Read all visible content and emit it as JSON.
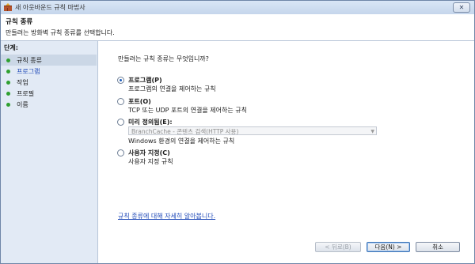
{
  "window": {
    "title": "새 아웃바운드 규칙 마법사",
    "close_glyph": "✕"
  },
  "header": {
    "title": "규칙 종류",
    "subtitle": "만들려는 방화벽 규칙 종류를 선택합니다."
  },
  "steps": {
    "title": "단계:",
    "items": [
      {
        "label": "규칙 종류",
        "active": true
      },
      {
        "label": "프로그램",
        "active": false
      },
      {
        "label": "작업",
        "active": false
      },
      {
        "label": "프로필",
        "active": false
      },
      {
        "label": "이름",
        "active": false
      }
    ]
  },
  "content": {
    "question": "만들려는 규칙 종류는 무엇입니까?",
    "options": [
      {
        "label": "프로그램(P)",
        "desc": "프로그램의 연결을 제어하는 규칙",
        "selected": true
      },
      {
        "label": "포트(O)",
        "desc": "TCP 또는 UDP 포트의 연결을 제어하는 규칙",
        "selected": false
      },
      {
        "label": "미리 정의됨(E):",
        "select_value": "BranchCache - 콘텐츠 검색(HTTP 사용)",
        "desc": "Windows 환경의 연결을 제어하는 규칙",
        "selected": false
      },
      {
        "label": "사용자 지정(C)",
        "desc": "사용자 지정 규칙",
        "selected": false
      }
    ],
    "learn_more": "규칙 종류에 대해 자세히 알아봅니다."
  },
  "buttons": {
    "back": "< 뒤로(B)",
    "next": "다음(N) >",
    "cancel": "취소"
  },
  "colors": {
    "accent": "#1d5dbb",
    "step_dot": "#2fa02f",
    "link": "#1f49b8"
  }
}
